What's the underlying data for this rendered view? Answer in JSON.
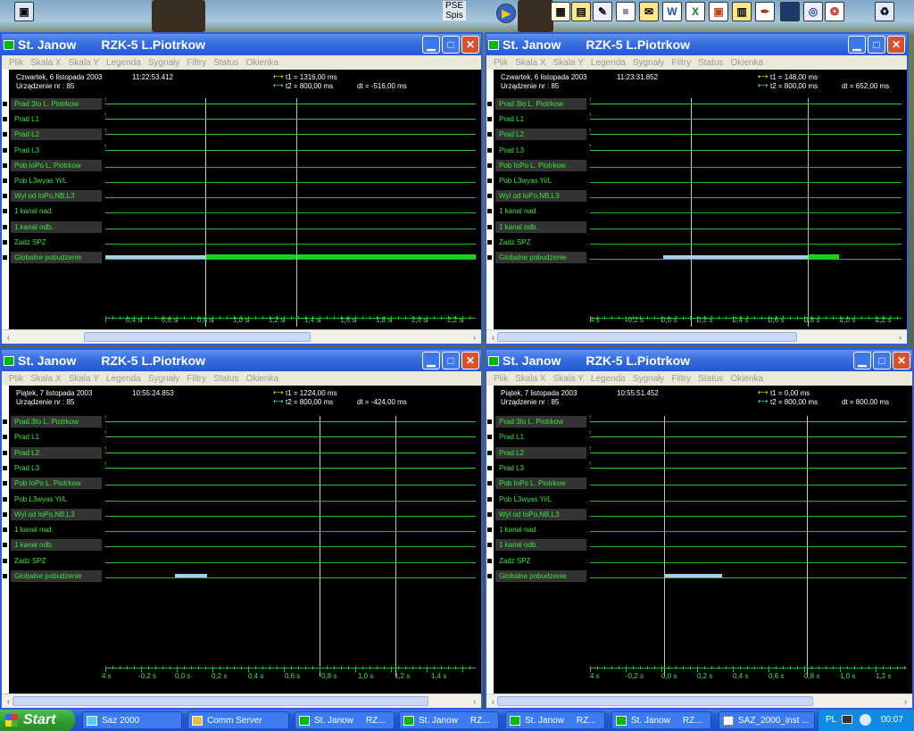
{
  "windows": [
    {
      "title": "St. Janow",
      "subtitle": "RZK-5 L.Piotrkow",
      "menu": [
        "Plik",
        "Skala X",
        "Skala Y",
        "Legenda",
        "Sygnały",
        "Filtry",
        "Status",
        "Okienka"
      ],
      "date": "Czwartek, 6  listopada  2003",
      "time": "11:22:53.412",
      "device": "Urządzenie nr :  85",
      "t1": "t1 = 1316,00 ms",
      "t2": "t2 = 800,00 ms",
      "dt": "dt = -516,00 ms",
      "signals": [
        "Prad 3Io L. Piotrkow",
        "Prad L1",
        "Prad L2",
        "Prad L3",
        "Pob IoPo L. Piotrkow",
        "Pob L3wyas Yi/L",
        "Wyl od IoPo,NB,L3",
        "1 kanal nad.",
        "1 kanal odb.",
        "Zadz SPZ",
        "Globalne pobudzenie"
      ],
      "ticks": [
        "0,4 s",
        "0,6 s",
        "0,8 s",
        "1,0 s",
        "1,2 s",
        "1,4 s",
        "1,6 s",
        "1,8 s",
        "2,0 s",
        "2,2 s"
      ]
    },
    {
      "title": "St. Janow",
      "subtitle": "RZK-5 L.Piotrkow",
      "menu": [
        "Plik",
        "Skala X",
        "Skala Y",
        "Legenda",
        "Sygnały",
        "Filtry",
        "Status",
        "Okienka"
      ],
      "date": "Czwartek, 6  listopada  2003",
      "time": "11:23:31.852",
      "device": "Urządzenie nr :  85",
      "t1": "t1 = 148,00 ms",
      "t2": "t2 = 800,00 ms",
      "dt": "dt = 652,00 ms",
      "signals": [
        "Prad 3Io L. Piotrkow",
        "Prad L1",
        "Prad L2",
        "Prad L3",
        "Pob IoPo L. Piotrkow",
        "Pob L3wyas Yi/L",
        "Wyl od IoPo,NB,L3",
        "1 kanal nad.",
        "1 kanal odb.",
        "Zadz SPZ",
        "Globalne pobudzenie"
      ],
      "ticks": [
        "4 s",
        "-0,2 s",
        "0,0 s",
        "0,2 s",
        "0,4 s",
        "0,6 s",
        "0,8 s",
        "1,0 s",
        "1,2 s"
      ]
    },
    {
      "title": "St. Janow",
      "subtitle": "RZK-5 L.Piotrkow",
      "menu": [
        "Plik",
        "Skala X",
        "Skala Y",
        "Legenda",
        "Sygnały",
        "Filtry",
        "Status",
        "Okienka"
      ],
      "date": "Piątek, 7  listopada  2003",
      "time": "10:55:24.853",
      "device": "Urządzenie nr :  85",
      "t1": "t1 = 1224,00 ms",
      "t2": "t2 = 800,00 ms",
      "dt": "dt = -424,00 ms",
      "signals": [
        "Prad 3Io L. Piotrkow",
        "Prad L1",
        "Prad L2",
        "Prad L3",
        "Pob IoPo L. Piotrkow",
        "Pob L3wyas Yi/L",
        "Wyl od IoPo,NB,L3",
        "1 kanal nad.",
        "1 kanal odb.",
        "Zadz SPZ",
        "Globalne pobudzenie"
      ],
      "ticks": [
        "4 s",
        "-0,2 s",
        "0,0 s",
        "0,2 s",
        "0,4 s",
        "0,6 s",
        "0,8 s",
        "1,0 s",
        "1,2 s",
        "1,4 s",
        "1,6 s"
      ]
    },
    {
      "title": "St. Janow",
      "subtitle": "RZK-5 L.Piotrkow",
      "menu": [
        "Plik",
        "Skala X",
        "Skala Y",
        "Legenda",
        "Sygnały",
        "Filtry",
        "Status",
        "Okienka"
      ],
      "date": "Piątek, 7  listopada  2003",
      "time": "10:55:51.452",
      "device": "Urządzenie nr :  85",
      "t1": "t1 = 0,00 ms",
      "t2": "t2 = 800,00 ms",
      "dt": "dt = 800,00 ms",
      "signals": [
        "Prad 3Io L. Piotrkow",
        "Prad L1",
        "Prad L2",
        "Prad L3",
        "Pob IoPo L. Piotrkow",
        "Pob L3wyas Yi/L",
        "Wyl od IoPo,NB,L3",
        "1 kanal nad.",
        "1 kanal odb.",
        "Zadz SPZ",
        "Globalne pobudzenie"
      ],
      "ticks": [
        "4 s",
        "-0,2 s",
        "0,0 s",
        "0,2 s",
        "0,4 s",
        "0,6 s",
        "0,8 s",
        "1,0 s",
        "1,2 s"
      ]
    }
  ],
  "desktop": {
    "pse_label": "PSE Spis"
  },
  "taskbar": {
    "start": "Start",
    "tasks": [
      {
        "label": "Saz 2000",
        "icon": "saz-icon"
      },
      {
        "label": "Comm Server",
        "icon": "comm-server-icon"
      },
      {
        "label": "St. Janow",
        "label2": "RZ...",
        "icon": "window-icon"
      },
      {
        "label": "St. Janow",
        "label2": "RZ...",
        "icon": "window-icon"
      },
      {
        "label": "St. Janow",
        "label2": "RZ...",
        "icon": "window-icon"
      },
      {
        "label": "St. Janow",
        "label2": "RZ...",
        "icon": "window-icon"
      },
      {
        "label": "SAZ_2000_inst ...",
        "icon": "document-icon"
      }
    ],
    "lang": "PL",
    "clock": "00:07"
  }
}
